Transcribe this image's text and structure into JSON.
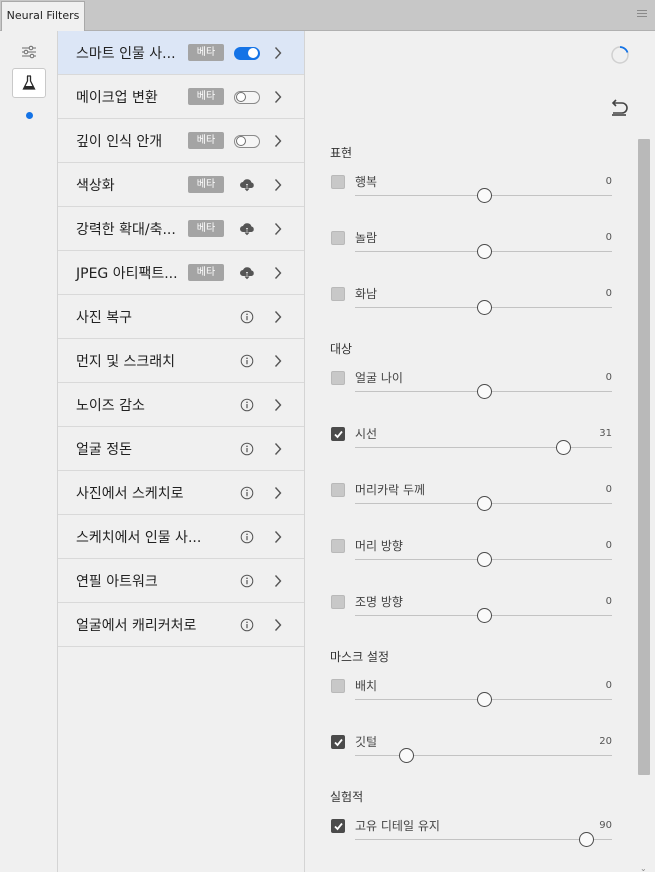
{
  "window": {
    "tab_title": "Neural Filters"
  },
  "strip": {
    "icons": [
      "sliders-icon",
      "flask-icon"
    ],
    "indicator_color": "#1473e6"
  },
  "filters": [
    {
      "label": "스마트 인물 사...",
      "badge": "베타",
      "control": "toggle-on"
    },
    {
      "label": "메이크업 변환",
      "badge": "베타",
      "control": "toggle-off"
    },
    {
      "label": "깊이 인식 안개",
      "badge": "베타",
      "control": "toggle-off"
    },
    {
      "label": "색상화",
      "badge": "베타",
      "control": "cloud-download"
    },
    {
      "label": "강력한 확대/축...",
      "badge": "베타",
      "control": "cloud-download"
    },
    {
      "label": "JPEG 아티팩트...",
      "badge": "베타",
      "control": "cloud-download"
    },
    {
      "label": "사진 복구",
      "badge": "",
      "control": "info"
    },
    {
      "label": "먼지 및 스크래치",
      "badge": "",
      "control": "info"
    },
    {
      "label": "노이즈 감소",
      "badge": "",
      "control": "info"
    },
    {
      "label": "얼굴 정돈",
      "badge": "",
      "control": "info"
    },
    {
      "label": "사진에서 스케치로",
      "badge": "",
      "control": "info"
    },
    {
      "label": "스케치에서 인물 사...",
      "badge": "",
      "control": "info"
    },
    {
      "label": "연필 아트워크",
      "badge": "",
      "control": "info"
    },
    {
      "label": "얼굴에서 캐리커처로",
      "badge": "",
      "control": "info"
    }
  ],
  "sections": [
    {
      "title": "표현",
      "options": [
        {
          "label": "행복",
          "value": "0",
          "checked": false,
          "level": 0.5
        },
        {
          "label": "놀람",
          "value": "0",
          "checked": false,
          "level": 0.5
        },
        {
          "label": "화남",
          "value": "0",
          "checked": false,
          "level": 0.5
        }
      ]
    },
    {
      "title": "대상",
      "options": [
        {
          "label": "얼굴 나이",
          "value": "0",
          "checked": false,
          "level": 0.5
        },
        {
          "label": "시선",
          "value": "31",
          "checked": true,
          "level": 0.81
        },
        {
          "label": "머리카락 두께",
          "value": "0",
          "checked": false,
          "level": 0.5
        },
        {
          "label": "머리 방향",
          "value": "0",
          "checked": false,
          "level": 0.5
        },
        {
          "label": "조명 방향",
          "value": "0",
          "checked": false,
          "level": 0.5
        }
      ]
    },
    {
      "title": "마스크 설정",
      "options": [
        {
          "label": "배치",
          "value": "0",
          "checked": false,
          "level": 0.5
        },
        {
          "label": "깃털",
          "value": "20",
          "checked": true,
          "level": 0.2
        }
      ]
    },
    {
      "title": "실험적",
      "options": [
        {
          "label": "고유 디테일 유지",
          "value": "90",
          "checked": true,
          "level": 0.9
        }
      ]
    }
  ]
}
